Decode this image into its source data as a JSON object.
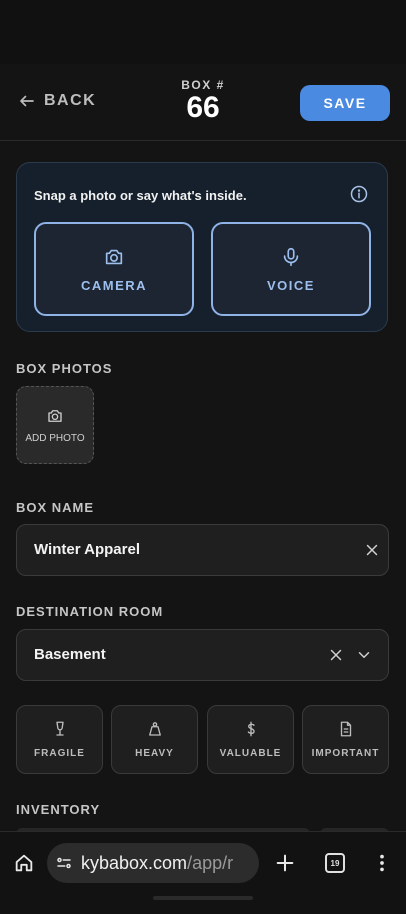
{
  "header": {
    "back_label": "BACK",
    "box_label": "BOX #",
    "box_number": "66",
    "save_label": "SAVE"
  },
  "capture": {
    "hint": "Snap a photo or say what's inside.",
    "camera_label": "CAMERA",
    "voice_label": "VOICE"
  },
  "photos": {
    "section_label": "BOX PHOTOS",
    "add_label": "ADD PHOTO"
  },
  "name": {
    "section_label": "BOX NAME",
    "value": "Winter Apparel"
  },
  "room": {
    "section_label": "DESTINATION ROOM",
    "value": "Basement"
  },
  "tags": [
    {
      "label": "FRAGILE",
      "icon": "wine-glass-icon"
    },
    {
      "label": "HEAVY",
      "icon": "weight-icon"
    },
    {
      "label": "VALUABLE",
      "icon": "dollar-icon"
    },
    {
      "label": "IMPORTANT",
      "icon": "document-icon"
    }
  ],
  "inventory": {
    "section_label": "INVENTORY"
  },
  "browser": {
    "url_domain": "kybabox.com",
    "url_path": "/app/r",
    "tab_count": "19"
  },
  "colors": {
    "accent": "#4a8ae0",
    "capture_border": "#8fb3e6",
    "background": "#141414"
  }
}
